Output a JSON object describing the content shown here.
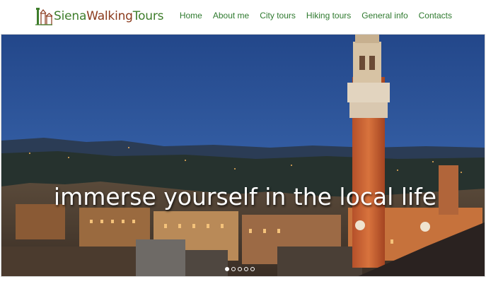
{
  "brand": {
    "word1": "Siena",
    "word2": "Walking",
    "word3": "Tours"
  },
  "nav": {
    "items": [
      {
        "label": "Home"
      },
      {
        "label": "About me"
      },
      {
        "label": "City tours"
      },
      {
        "label": "Hiking tours"
      },
      {
        "label": "General info"
      },
      {
        "label": "Contacts"
      }
    ]
  },
  "hero": {
    "caption": "immerse yourself in the local life",
    "slide_count": 5,
    "active_slide": 1
  },
  "colors": {
    "nav_text": "#2f7a2f",
    "brand_green": "#3e7d2b",
    "brand_brown": "#8a3a1c",
    "sky_top": "#23478a",
    "sky_bottom": "#3a66ad"
  }
}
